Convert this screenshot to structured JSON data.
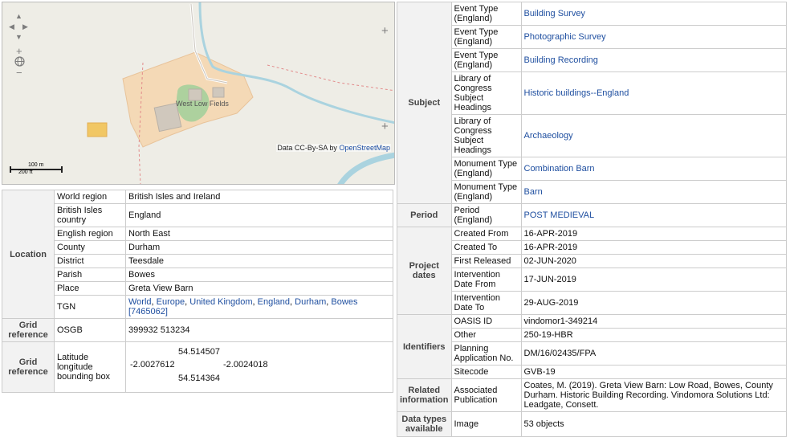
{
  "map": {
    "place_label": "West Low Fields",
    "attribution_prefix": "Data CC-By-SA by",
    "attribution_link": "OpenStreetMap",
    "scale_m": "100 m",
    "scale_ft": "200 ft",
    "controls": {
      "up": "▲",
      "left": "◀",
      "right": "▶",
      "down": "▼",
      "zoom_in": "+",
      "zoom_out": "−",
      "expand": "+"
    }
  },
  "location": {
    "header": "Location",
    "rows": [
      {
        "key": "World region",
        "value": "British Isles and Ireland"
      },
      {
        "key": "British Isles country",
        "value": "England"
      },
      {
        "key": "English region",
        "value": "North East"
      },
      {
        "key": "County",
        "value": "Durham"
      },
      {
        "key": "District",
        "value": "Teesdale"
      },
      {
        "key": "Parish",
        "value": "Bowes"
      },
      {
        "key": "Place",
        "value": "Greta View Barn"
      }
    ],
    "tgn_key": "TGN",
    "tgn_links": [
      "World",
      "Europe",
      "United Kingdom",
      "England",
      "Durham",
      "Bowes"
    ],
    "tgn_id": "[7465062]"
  },
  "grid_osgb": {
    "header": "Grid reference",
    "key": "OSGB",
    "value": "399932 513234"
  },
  "grid_latlon": {
    "header": "Grid reference",
    "key": "Latitude longitude bounding box",
    "north": "54.514507",
    "west": "-2.0027612",
    "east": "-2.0024018",
    "south": "54.514364"
  },
  "subject": {
    "header": "Subject",
    "rows": [
      {
        "key": "Event Type (England)",
        "value": "Building Survey"
      },
      {
        "key": "Event Type (England)",
        "value": "Photographic Survey"
      },
      {
        "key": "Event Type (England)",
        "value": "Building Recording"
      },
      {
        "key": "Library of Congress Subject Headings",
        "value": "Historic buildings--England"
      },
      {
        "key": "Library of Congress Subject Headings",
        "value": "Archaeology"
      },
      {
        "key": "Monument Type (England)",
        "value": "Combination Barn"
      },
      {
        "key": "Monument Type (England)",
        "value": "Barn"
      }
    ]
  },
  "period": {
    "header": "Period",
    "key": "Period (England)",
    "value": "POST MEDIEVAL"
  },
  "project_dates": {
    "header": "Project dates",
    "rows": [
      {
        "key": "Created From",
        "value": "16-APR-2019"
      },
      {
        "key": "Created To",
        "value": "16-APR-2019"
      },
      {
        "key": "First Released",
        "value": "02-JUN-2020"
      },
      {
        "key": "Intervention Date From",
        "value": "17-JUN-2019"
      },
      {
        "key": "Intervention Date To",
        "value": "29-AUG-2019"
      }
    ]
  },
  "identifiers": {
    "header": "Identifiers",
    "rows": [
      {
        "key": "OASIS ID",
        "value": "vindomor1-349214"
      },
      {
        "key": "Other",
        "value": "250-19-HBR"
      },
      {
        "key": "Planning Application No.",
        "value": "DM/16/02435/FPA"
      },
      {
        "key": "Sitecode",
        "value": "GVB-19"
      }
    ]
  },
  "related": {
    "header": "Related information",
    "key": "Associated Publication",
    "value": "Coates, M. (2019). Greta View Barn: Low Road, Bowes, County Durham. Historic Building Recording. Vindomora Solutions Ltd: Leadgate, Consett."
  },
  "data_types": {
    "header": "Data types available",
    "key": "Image",
    "value": "53 objects"
  },
  "colors": {
    "link": "#1f4fa0",
    "header_bg": "#f2f2f2",
    "border": "#cccccc",
    "map_bg": "#eeede6",
    "water": "#aad3df",
    "farmland": "#f4d9b6"
  }
}
